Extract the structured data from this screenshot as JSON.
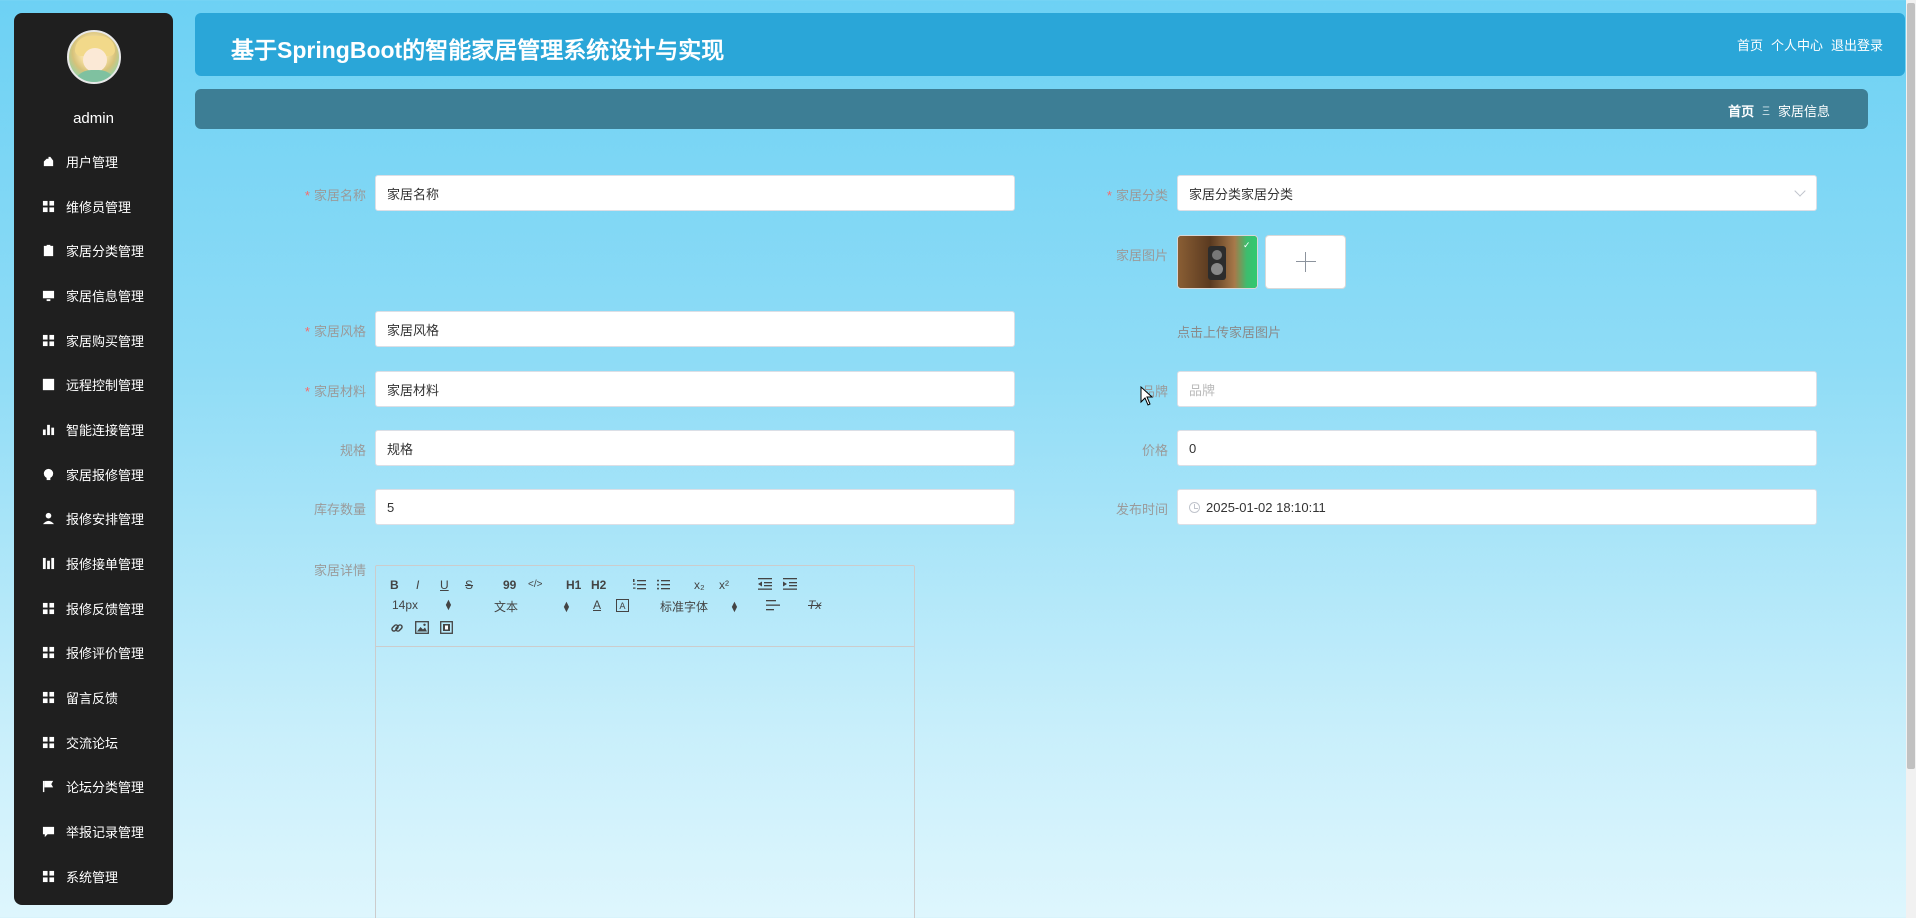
{
  "sidebar": {
    "username": "admin",
    "items": [
      {
        "label": "用户管理",
        "icon": "user-icon"
      },
      {
        "label": "维修员管理",
        "icon": "grid-icon"
      },
      {
        "label": "家居分类管理",
        "icon": "clipboard-icon"
      },
      {
        "label": "家居信息管理",
        "icon": "monitor-icon"
      },
      {
        "label": "家居购买管理",
        "icon": "grid-icon"
      },
      {
        "label": "远程控制管理",
        "icon": "chart-icon"
      },
      {
        "label": "智能连接管理",
        "icon": "bar-chart-icon"
      },
      {
        "label": "家居报修管理",
        "icon": "bulb-icon"
      },
      {
        "label": "报修安排管理",
        "icon": "person-icon"
      },
      {
        "label": "报修接单管理",
        "icon": "bar-icon"
      },
      {
        "label": "报修反馈管理",
        "icon": "grid-icon"
      },
      {
        "label": "报修评价管理",
        "icon": "grid-icon"
      },
      {
        "label": "留言反馈",
        "icon": "grid-icon"
      },
      {
        "label": "交流论坛",
        "icon": "grid-icon"
      },
      {
        "label": "论坛分类管理",
        "icon": "flag-icon"
      },
      {
        "label": "举报记录管理",
        "icon": "comment-icon"
      },
      {
        "label": "系统管理",
        "icon": "grid-icon"
      }
    ]
  },
  "header": {
    "title": "基于SpringBoot的智能家居管理系统设计与实现",
    "links": {
      "home": "首页",
      "profile": "个人中心",
      "logout": "退出登录"
    }
  },
  "breadcrumb": {
    "home": "首页",
    "separator": "Ξ",
    "current": "家居信息"
  },
  "form": {
    "name": {
      "label": "家居名称",
      "value": "家居名称",
      "required": true
    },
    "category": {
      "label": "家居分类",
      "value": "家居分类家居分类",
      "required": true
    },
    "image": {
      "label": "家居图片",
      "hint": "点击上传家居图片"
    },
    "style": {
      "label": "家居风格",
      "value": "家居风格",
      "required": true
    },
    "material": {
      "label": "家居材料",
      "value": "家居材料",
      "required": true
    },
    "brand": {
      "label": "品牌",
      "placeholder": "品牌"
    },
    "spec": {
      "label": "规格",
      "value": "规格"
    },
    "price": {
      "label": "价格",
      "value": "0"
    },
    "stock": {
      "label": "库存数量",
      "value": "5"
    },
    "publish_time": {
      "label": "发布时间",
      "value": "2025-01-02 18:10:11"
    },
    "detail": {
      "label": "家居详情"
    },
    "required_mark": "*"
  },
  "editor": {
    "font_size": "14px",
    "block_type": "文本",
    "font_family": "标准字体",
    "buttons": {
      "bold": "B",
      "italic": "I",
      "underline": "U",
      "strike": "S",
      "quote": "99",
      "code": "</>",
      "h1": "H1",
      "h2": "H2",
      "sub": "x₂",
      "sup": "x²",
      "font_color": "A",
      "clean": "Tx"
    }
  }
}
